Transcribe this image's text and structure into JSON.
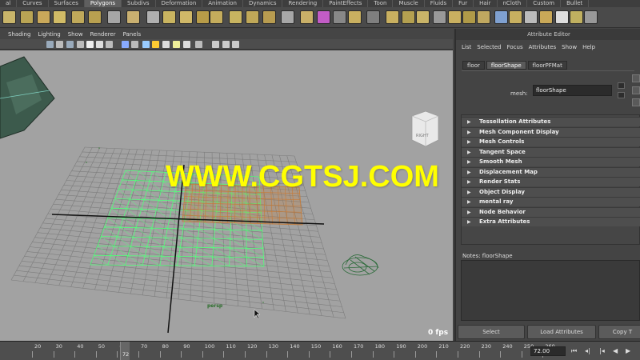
{
  "shelf_tabs": [
    {
      "label": "al",
      "active": false
    },
    {
      "label": "Curves",
      "active": false
    },
    {
      "label": "Surfaces",
      "active": false
    },
    {
      "label": "Polygons",
      "active": true
    },
    {
      "label": "Subdivs",
      "active": false
    },
    {
      "label": "Deformation",
      "active": false
    },
    {
      "label": "Animation",
      "active": false
    },
    {
      "label": "Dynamics",
      "active": false
    },
    {
      "label": "Rendering",
      "active": false
    },
    {
      "label": "PaintEffects",
      "active": false
    },
    {
      "label": "Toon",
      "active": false
    },
    {
      "label": "Muscle",
      "active": false
    },
    {
      "label": "Fluids",
      "active": false
    },
    {
      "label": "Fur",
      "active": false
    },
    {
      "label": "Hair",
      "active": false
    },
    {
      "label": "nCloth",
      "active": false
    },
    {
      "label": "Custom",
      "active": false
    },
    {
      "label": "Bullet",
      "active": false
    }
  ],
  "panel_menu": [
    "Shading",
    "Lighting",
    "Show",
    "Renderer",
    "Panels"
  ],
  "viewport": {
    "camera_label": "persp",
    "view_cube_label": "RIGHT",
    "fps": "0 fps",
    "watermark": "WWW.CGTSJ.COM"
  },
  "attribute_editor": {
    "title": "Attribute Editor",
    "menu": [
      "List",
      "Selected",
      "Focus",
      "Attributes",
      "Show",
      "Help"
    ],
    "tabs": [
      {
        "label": "floor",
        "active": false
      },
      {
        "label": "floorShape",
        "active": true
      },
      {
        "label": "floorPFMat",
        "active": false
      }
    ],
    "mesh_label": "mesh:",
    "mesh_value": "floorShape",
    "sections": [
      "Tessellation Attributes",
      "Mesh Component Display",
      "Mesh Controls",
      "Tangent Space",
      "Smooth Mesh",
      "Displacement Map",
      "Render Stats",
      "Object Display",
      "mental ray",
      "Node Behavior",
      "Extra Attributes"
    ],
    "notes_label": "Notes:  floorShape",
    "buttons": {
      "select": "Select",
      "load_attributes": "Load Attributes",
      "copy_tab": "Copy T"
    }
  },
  "time_slider": {
    "ticks": [
      "20",
      "30",
      "40",
      "50",
      "60",
      "70",
      "80",
      "90",
      "100",
      "110",
      "120",
      "130",
      "140",
      "150",
      "160",
      "170",
      "180",
      "190",
      "200",
      "210",
      "220",
      "230",
      "240",
      "250",
      "260"
    ],
    "current_frame": "72",
    "current_time": "72.00"
  },
  "colors": {
    "viewport_bg": "#a2a2a2",
    "grid_line": "#7c7c7c",
    "green_wire": "#52ff7a",
    "orange_wire": "#c87a34",
    "watermark": "#ffff00"
  }
}
